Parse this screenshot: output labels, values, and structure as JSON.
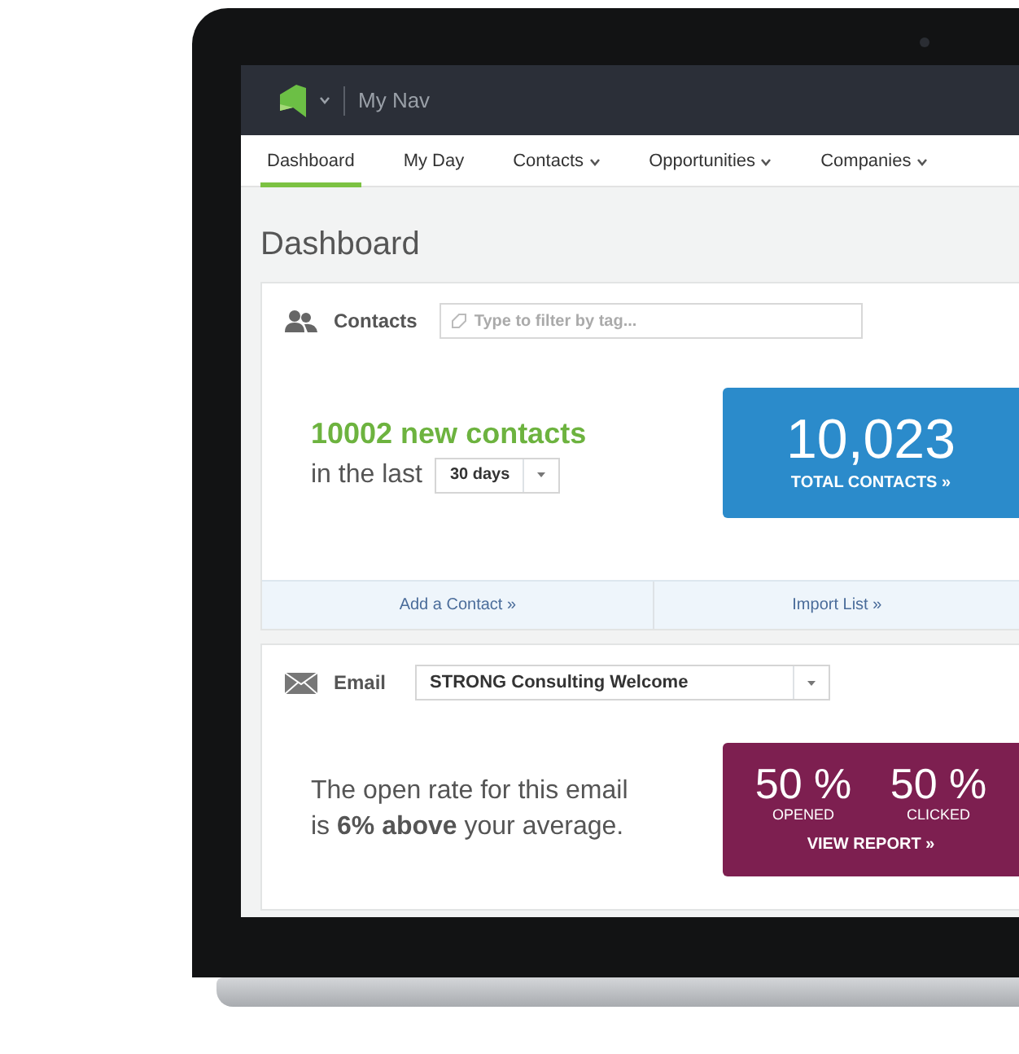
{
  "topbar": {
    "nav_name": "My Nav"
  },
  "tabs": [
    {
      "label": "Dashboard",
      "selected": true,
      "has_menu": false
    },
    {
      "label": "My Day",
      "selected": false,
      "has_menu": false
    },
    {
      "label": "Contacts",
      "selected": false,
      "has_menu": true
    },
    {
      "label": "Opportunities",
      "selected": false,
      "has_menu": true
    },
    {
      "label": "Companies",
      "selected": false,
      "has_menu": true
    }
  ],
  "page_title": "Dashboard",
  "contacts": {
    "title": "Contacts",
    "filter": {
      "placeholder": "Type to filter by tag..."
    },
    "headline": "10002 new contacts",
    "period_label": "in the last",
    "period": "30 days",
    "total": "10,023",
    "total_label": "TOTAL CONTACTS »",
    "links": [
      "Add a Contact »",
      "Import List »"
    ]
  },
  "email": {
    "title": "Email",
    "selected_email": "STRONG Consulting Welcome",
    "message": "The open rate for this email is **6% above** your average.",
    "stats": [
      {
        "value": "50 %",
        "label": "OPENED"
      },
      {
        "value": "50 %",
        "label": "CLICKED"
      }
    ],
    "report_link": "VIEW REPORT »"
  }
}
